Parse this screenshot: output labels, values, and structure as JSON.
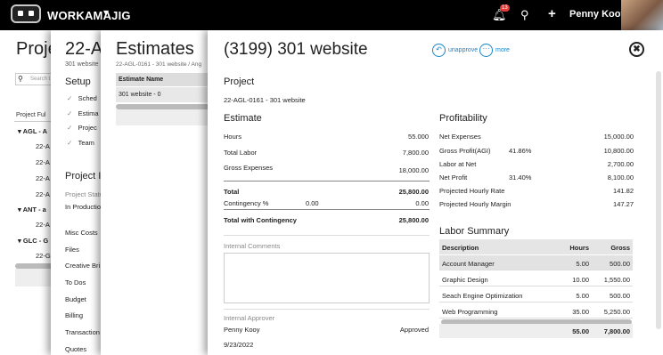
{
  "topbar": {
    "brand": "WORKAMAJIG",
    "notifications": "13",
    "user": "Penny Kooy"
  },
  "p1": {
    "title": "Proje",
    "search": "Search t",
    "col": "Project Ful",
    "groups": [
      {
        "label": "AGL - A",
        "items": [
          "22-A",
          "22-A",
          "22-A",
          "22-A"
        ]
      },
      {
        "label": "ANT - a",
        "items": [
          "22-A"
        ]
      },
      {
        "label": "GLC - G",
        "items": [
          "22-G"
        ]
      }
    ]
  },
  "p2": {
    "title": "22-A",
    "sub": "301 website",
    "setup": "Setup",
    "steps": [
      "Sched",
      "Estima",
      "Projec",
      "Team"
    ],
    "proj": "Project I",
    "status_label": "Project Statu",
    "status": "In Productio",
    "nav": [
      "Misc Costs",
      "Files",
      "Creative Bri",
      "To Dos",
      "Budget",
      "Billing",
      "Transaction",
      "Quotes"
    ]
  },
  "p3": {
    "title": "Estimates",
    "crumb": "22-AGL-0161 - 301 website / Ang",
    "col": "Estimate Name",
    "row": "301 website - 0"
  },
  "main": {
    "title": "(3199) 301 website",
    "unapprove": "unapprove",
    "more": "more",
    "project_label": "Project",
    "project_link": "22-AGL-0161 - 301 website",
    "estimate": {
      "title": "Estimate",
      "hours_l": "Hours",
      "hours": "55.000",
      "labor_l": "Total Labor",
      "labor": "7,800.00",
      "gross_l": "Gross Expenses",
      "gross": "18,000.00",
      "total_l": "Total",
      "total": "25,800.00",
      "cont_l": "Contingency %",
      "cont_pct": "0.00",
      "cont": "0.00",
      "twc_l": "Total with Contingency",
      "twc": "25,800.00"
    },
    "comments_label": "Internal Comments",
    "approver_label": "Internal Approver",
    "approver": "Penny Kooy",
    "approved": "Approved",
    "date": "9/23/2022",
    "profit": {
      "title": "Profitability",
      "rows": [
        {
          "label": "Net Expenses",
          "pct": "",
          "value": "15,000.00"
        },
        {
          "label": "Gross Profit(AGI)",
          "pct": "41.86%",
          "value": "10,800.00"
        },
        {
          "label": "Labor at Net",
          "pct": "",
          "value": "2,700.00"
        },
        {
          "label": "Net Profit",
          "pct": "31.40%",
          "value": "8,100.00"
        },
        {
          "label": "Projected Hourly Rate",
          "pct": "",
          "value": "141.82"
        },
        {
          "label": "Projected Hourly Margin",
          "pct": "",
          "value": "147.27"
        }
      ]
    },
    "labor": {
      "title": "Labor Summary",
      "h_desc": "Description",
      "h_hours": "Hours",
      "h_gross": "Gross",
      "rows": [
        {
          "desc": "Account Manager",
          "hours": "5.00",
          "gross": "500.00"
        },
        {
          "desc": "Graphic Design",
          "hours": "10.00",
          "gross": "1,550.00"
        },
        {
          "desc": "Seach Engine Optimization",
          "hours": "5.00",
          "gross": "500.00"
        },
        {
          "desc": "Web Programming",
          "hours": "35.00",
          "gross": "5,250.00"
        }
      ],
      "total_hours": "55.00",
      "total_gross": "7,800.00"
    }
  }
}
